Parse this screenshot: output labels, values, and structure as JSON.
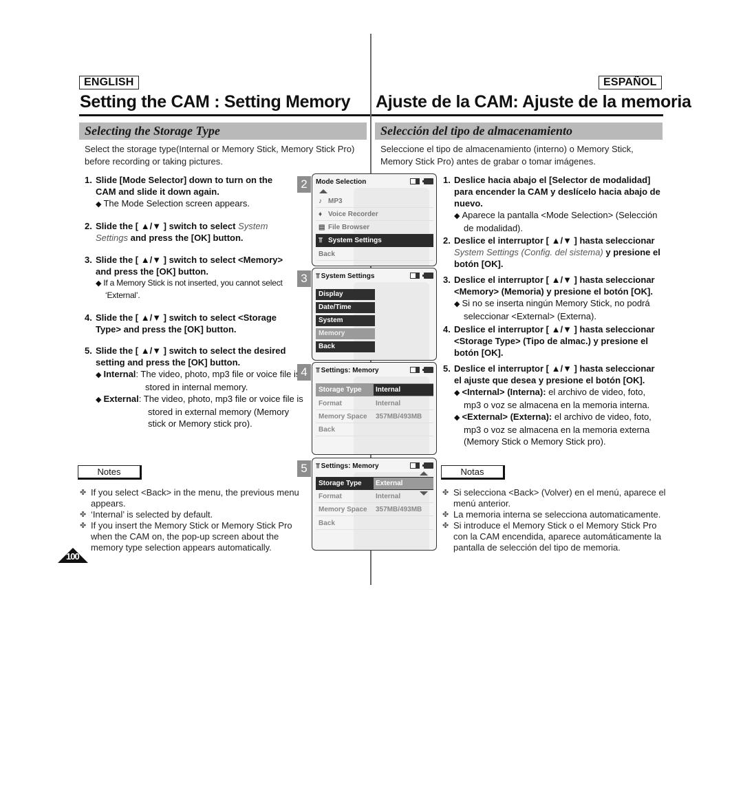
{
  "english": {
    "lang_tag": "ENGLISH",
    "title": "Setting the CAM : Setting Memory",
    "section": "Selecting the Storage Type",
    "intro": "Select the storage type(Internal or Memory Stick, Memory Stick Pro) before recording or taking pictures.",
    "steps": [
      {
        "num": "1.",
        "text": "Slide [Mode Selector] down to turn on the CAM and slide it down again.",
        "subs": [
          "The Mode Selection screen appears."
        ]
      },
      {
        "num": "2.",
        "pre": "Slide the [ ▲/▼ ] switch to select ",
        "italic": "System Settings",
        "post": " and press the [OK] button."
      },
      {
        "num": "3.",
        "text": "Slide the [ ▲/▼ ] switch to select <Memory> and press the [OK] button.",
        "subs": [
          "If a Memory Stick is not inserted, you cannot select ‘External’."
        ]
      },
      {
        "num": "4.",
        "text": "Slide the [ ▲/▼ ] switch to select <Storage Type> and press the [OK] button."
      },
      {
        "num": "5.",
        "text": "Slide the [ ▲/▼ ] switch to select the desired setting and press the [OK] button.",
        "subs": [
          {
            "label": "Internal",
            "text": ": The video, photo, mp3 file or voice file is stored in internal memory."
          },
          {
            "label": "External",
            "text": ": The video, photo, mp3 file or voice file is stored in external memory (Memory stick or Memory stick pro)."
          }
        ]
      }
    ],
    "notes_label": "Notes",
    "notes": [
      "If you select <Back> in the menu, the previous menu appears.",
      "‘Internal’ is selected by default.",
      "If you insert the Memory Stick or Memory Stick Pro when the CAM on, the pop-up screen about the memory type selection appears automatically."
    ],
    "page_number": "100"
  },
  "spanish": {
    "lang_tag": "ESPAÑOL",
    "title": "Ajuste de la CAM: Ajuste de la memoria",
    "section": "Selección del tipo de almacenamiento",
    "intro": "Seleccione el tipo de almacenamiento (interno) o Memory Stick, Memory Stick Pro) antes de grabar o tomar imágenes.",
    "steps": [
      {
        "num": "1.",
        "text": "Deslice hacia abajo el [Selector de modalidad] para encender la CAM y deslícelo hacia abajo de nuevo.",
        "subs": [
          "Aparece la pantalla <Mode Selection> (Selección de modalidad)."
        ]
      },
      {
        "num": "2.",
        "pre": "Deslice el interruptor [ ▲/▼ ] hasta seleccionar ",
        "italic": "System Settings (Config. del sistema)",
        "post": " y presione el botón [OK]."
      },
      {
        "num": "3.",
        "text": "Deslice el interruptor [ ▲/▼ ] hasta seleccionar <Memory>  (Memoria) y presione el botón [OK].",
        "subs": [
          "Si no se inserta ningún Memory Stick, no podrá seleccionar <External> (Externa)."
        ]
      },
      {
        "num": "4.",
        "text": "Deslice el interruptor [ ▲/▼ ] hasta seleccionar <Storage Type> (Tipo de almac.) y presione el botón [OK]."
      },
      {
        "num": "5.",
        "text": "Deslice el interruptor [ ▲/▼ ] hasta seleccionar el ajuste que desea y presione el botón [OK].",
        "subs": [
          {
            "label": "<Internal> (Interna):",
            "text": " el archivo de video, foto, mp3 o voz se almacena en la memoria interna."
          },
          {
            "label": "<External> (Externa):",
            "text": " el archivo de video, foto, mp3 o voz se almacena en la memoria externa (Memory Stick o Memory Stick pro)."
          }
        ]
      }
    ],
    "notes_label": "Notas",
    "notes": [
      "Si selecciona <Back> (Volver) en el menú, aparece el menú anterior.",
      "La memoria interna se selecciona automaticamente.",
      "Si introduce el Memory Stick o el Memory Stick Pro con la CAM encendida, aparece automáticamente la pantalla de selección del tipo de memoria."
    ]
  },
  "screens": [
    {
      "step": "2",
      "title": "Mode Selection",
      "items": [
        {
          "icon": "music-note-icon",
          "glyph": "♪",
          "label": "MP3"
        },
        {
          "icon": "microphone-icon",
          "glyph": "🎙",
          "label": "Voice Recorder"
        },
        {
          "icon": "file-icon",
          "glyph": "▤",
          "label": "File Browser"
        },
        {
          "icon": "settings-icon",
          "glyph": "⚒",
          "label": "System Settings",
          "selected": true
        },
        {
          "label": "Back"
        }
      ]
    },
    {
      "step": "3",
      "title": "System Settings",
      "items": [
        "Display",
        "Date/Time",
        "System",
        "Memory",
        "Back"
      ],
      "highlighted": "Memory"
    },
    {
      "step": "4",
      "title": "Settings: Memory",
      "rows": [
        {
          "key": "Storage Type",
          "value": "Internal"
        },
        {
          "key": "Format",
          "value": "Internal"
        },
        {
          "key": "Memory Space",
          "value": "357MB/493MB"
        },
        {
          "key": "Back",
          "value": ""
        }
      ]
    },
    {
      "step": "5",
      "title": "Settings: Memory",
      "rows": [
        {
          "key": "Storage Type",
          "value": "External"
        },
        {
          "key": "Format",
          "value": "Internal"
        },
        {
          "key": "Memory Space",
          "value": "357MB/493MB"
        },
        {
          "key": "Back",
          "value": ""
        }
      ]
    }
  ]
}
